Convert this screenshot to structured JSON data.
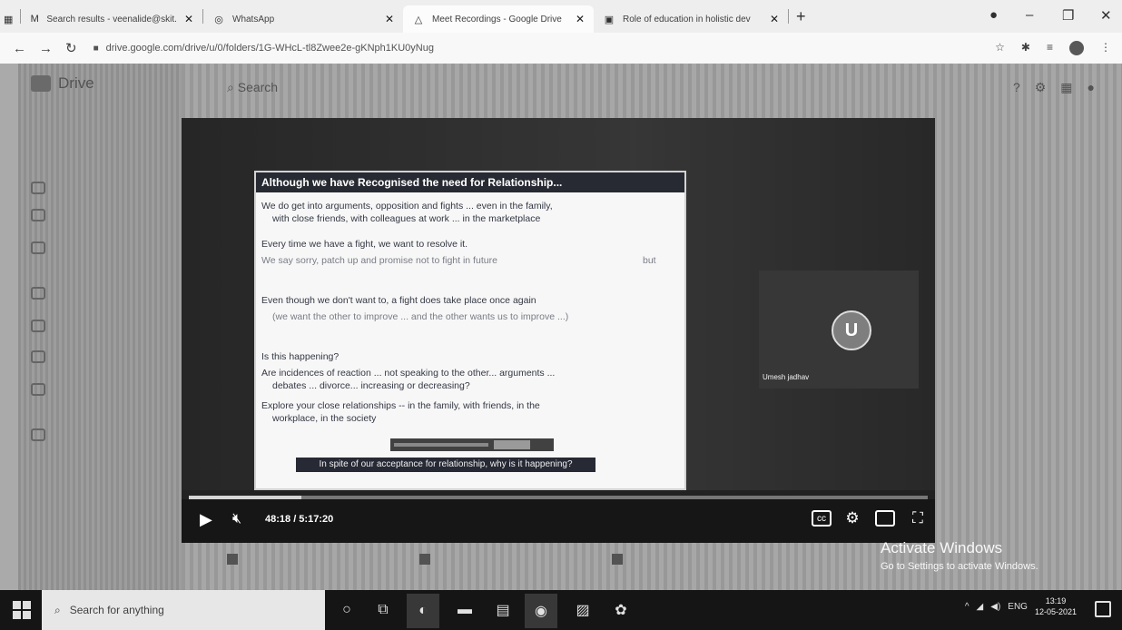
{
  "tabs": [
    {
      "label": "Search results - veenalide@skit.",
      "icon": "gmail-icon"
    },
    {
      "label": "WhatsApp",
      "icon": "whatsapp-icon"
    },
    {
      "label": "Meet Recordings - Google Drive",
      "icon": "drive-icon"
    },
    {
      "label": "Role of education in holistic dev",
      "icon": "slides-icon"
    }
  ],
  "address_bar": {
    "url": "drive.google.com/drive/u/0/folders/1G-WHcL-tl8Zwee2e-gKNph1KU0yNug"
  },
  "drive": {
    "logo_text": "Drive",
    "search": "Search"
  },
  "slide": {
    "title": "Although we have Recognised the need for Relationship...",
    "lines": [
      "We do get into arguments, opposition and fights ... even in the family,",
      "with close friends, with colleagues at work ... in the marketplace",
      "Every time we have a fight, we want to resolve it.",
      "We say sorry, patch up and promise not to fight in future",
      "but",
      "Even though we don't want to, a fight does take place once again",
      "(we want the other to improve ... and the other wants us to improve ...)",
      "Is this happening?",
      "Are incidences of reaction ... not speaking to the other... arguments ...",
      "debates ... divorce... increasing or decreasing?",
      "Explore your close relationships -- in the family, with friends, in the",
      "workplace, in the society"
    ],
    "caption": "In spite of our acceptance for relationship, why is it happening?"
  },
  "participant": {
    "initial": "U",
    "name": "Umesh jadhav"
  },
  "player": {
    "timecode": "48:18 / 5:17:20",
    "progress": 0.152
  },
  "activate": {
    "title": "Activate Windows",
    "subtitle": "Go to Settings to activate Windows."
  },
  "taskbar": {
    "search_placeholder": "Search for anything",
    "language": "ENG",
    "time": "13:19",
    "date": "12-05-2021"
  },
  "colors": {
    "slide_title_bg": "#1f2d63",
    "slide_text": "#243a8a"
  }
}
